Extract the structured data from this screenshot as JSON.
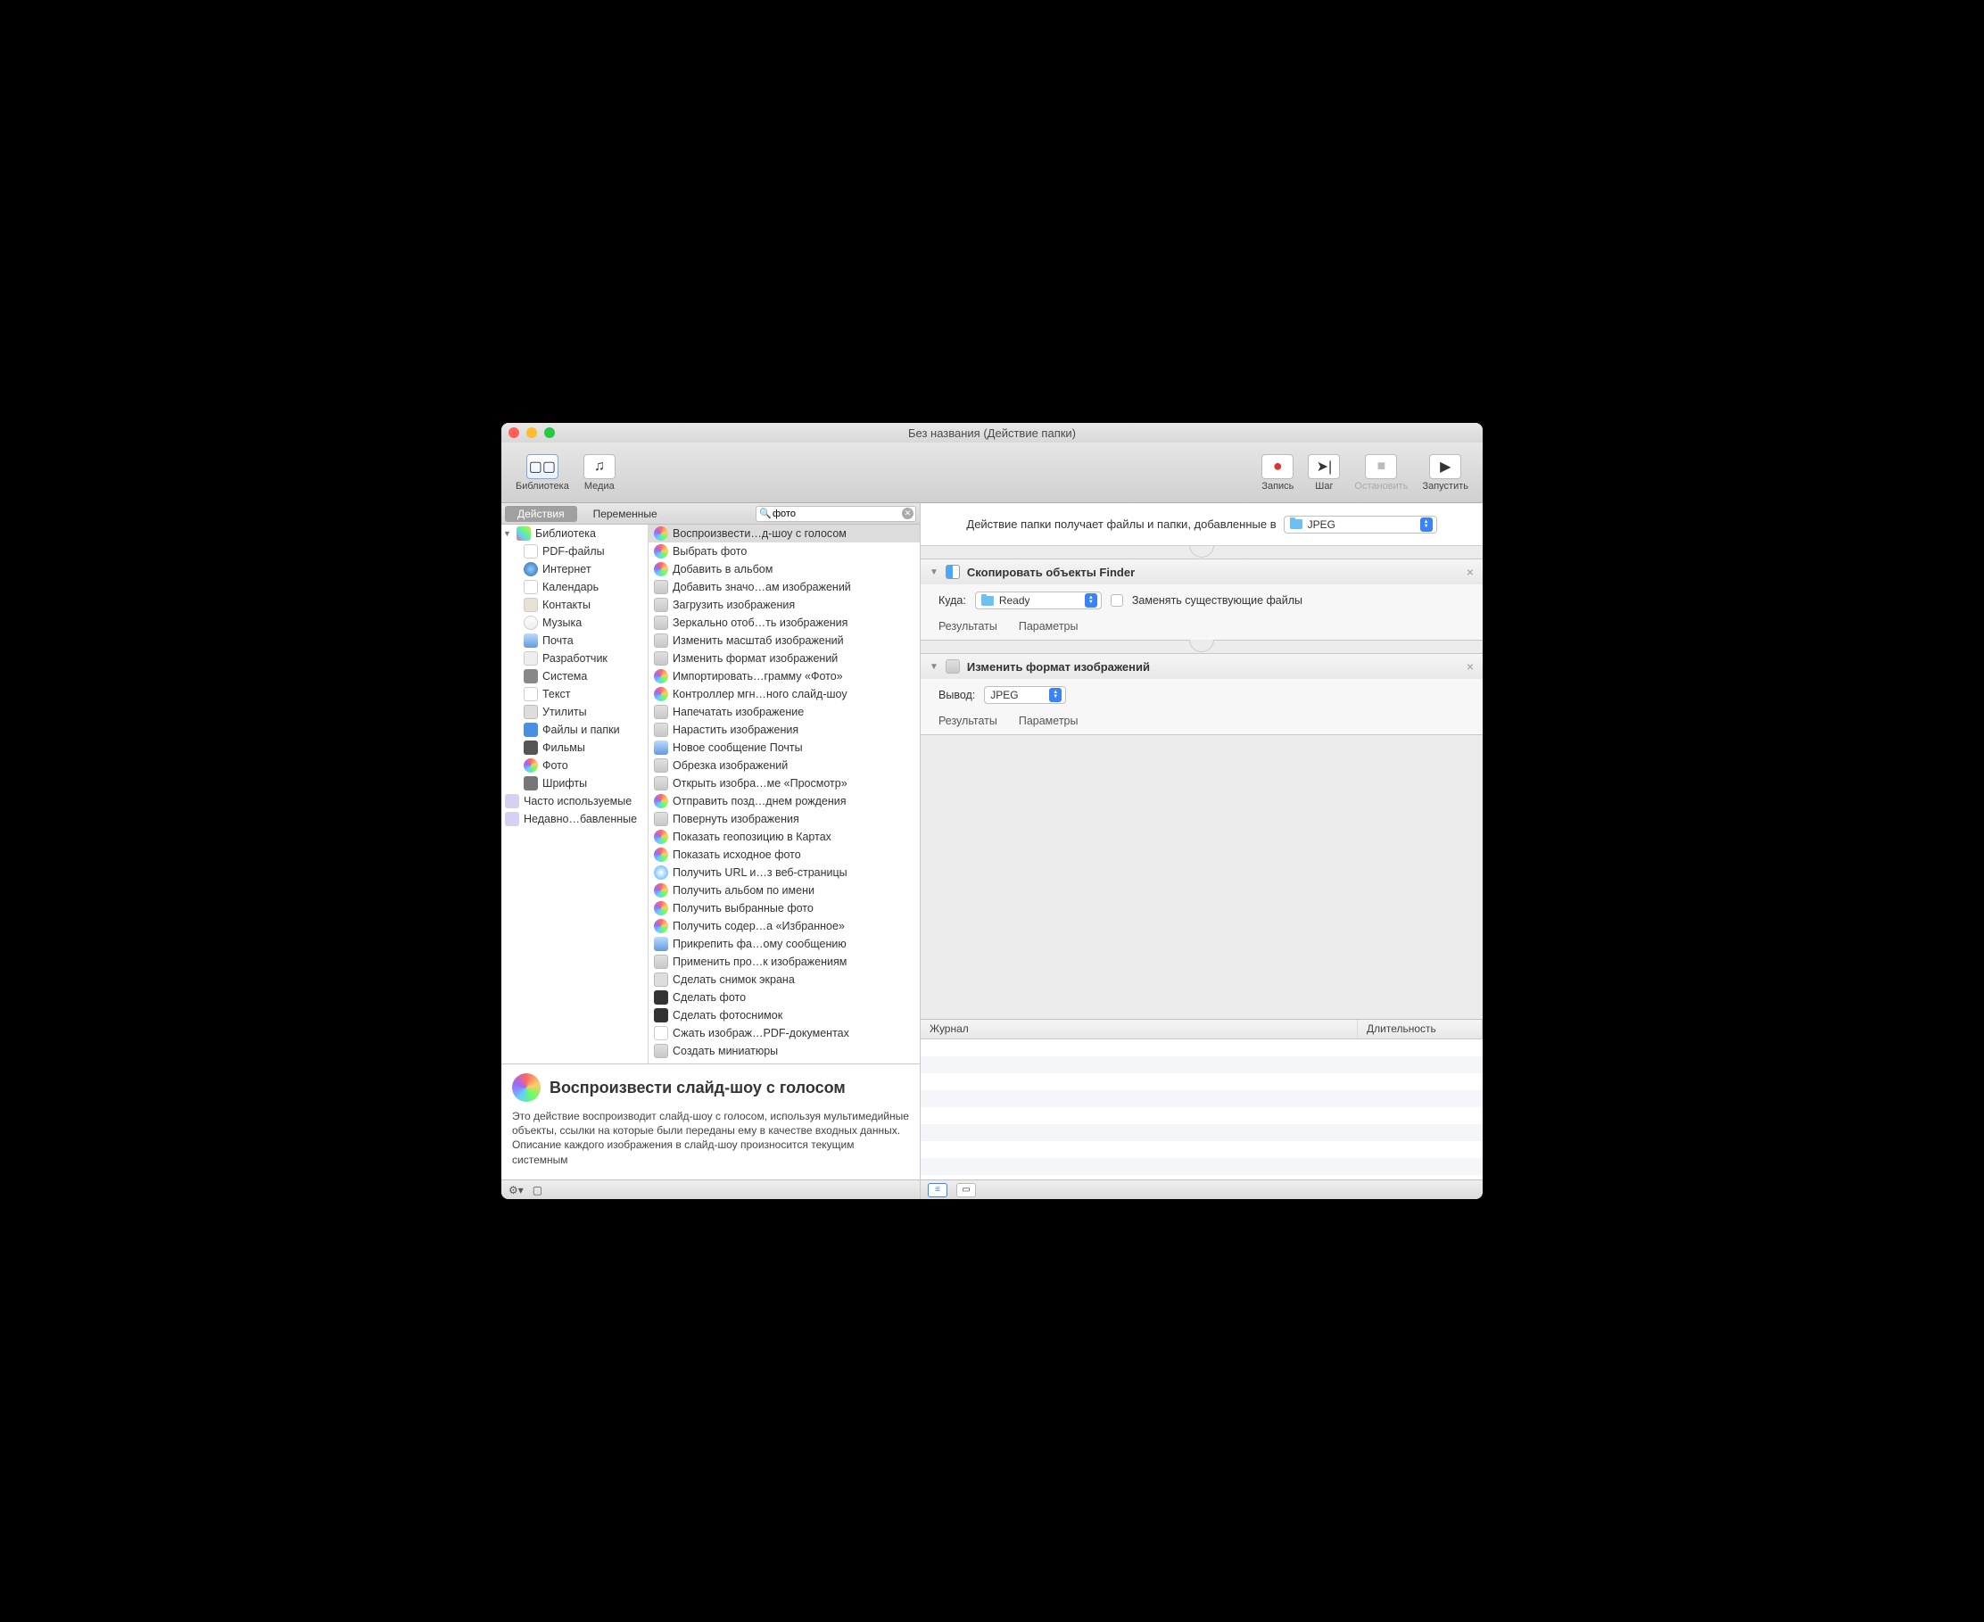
{
  "window": {
    "title": "Без названия (Действие папки)"
  },
  "toolbar": {
    "library": "Библиотека",
    "media": "Медиа",
    "record": "Запись",
    "step": "Шаг",
    "stop": "Остановить",
    "run": "Запустить"
  },
  "tabs": {
    "actions": "Действия",
    "variables": "Переменные"
  },
  "search": {
    "value": "фото"
  },
  "categories": [
    {
      "label": "Библиотека",
      "icon": "lib",
      "top": true
    },
    {
      "label": "PDF-файлы",
      "icon": "pdf"
    },
    {
      "label": "Интернет",
      "icon": "net"
    },
    {
      "label": "Календарь",
      "icon": "cal"
    },
    {
      "label": "Контакты",
      "icon": "con"
    },
    {
      "label": "Музыка",
      "icon": "mus"
    },
    {
      "label": "Почта",
      "icon": "mail"
    },
    {
      "label": "Разработчик",
      "icon": "dev"
    },
    {
      "label": "Система",
      "icon": "sys"
    },
    {
      "label": "Текст",
      "icon": "txt"
    },
    {
      "label": "Утилиты",
      "icon": "util"
    },
    {
      "label": "Файлы и папки",
      "icon": "file"
    },
    {
      "label": "Фильмы",
      "icon": "film"
    },
    {
      "label": "Фото",
      "icon": "photo"
    },
    {
      "label": "Шрифты",
      "icon": "font"
    },
    {
      "label": "Часто используемые",
      "icon": "fav",
      "group": true
    },
    {
      "label": "Недавно…бавленные",
      "icon": "fav",
      "group": true
    }
  ],
  "actions": [
    {
      "label": "Воспроизвести…д-шоу с голосом",
      "icon": "photo",
      "selected": true
    },
    {
      "label": "Выбрать фото",
      "icon": "photo"
    },
    {
      "label": "Добавить в альбом",
      "icon": "photo"
    },
    {
      "label": "Добавить значо…ам изображений",
      "icon": "img"
    },
    {
      "label": "Загрузить изображения",
      "icon": "img"
    },
    {
      "label": "Зеркально отоб…ть изображения",
      "icon": "img"
    },
    {
      "label": "Изменить масштаб изображений",
      "icon": "img"
    },
    {
      "label": "Изменить формат изображений",
      "icon": "img"
    },
    {
      "label": "Импортировать…грамму «Фото»",
      "icon": "photo"
    },
    {
      "label": "Контроллер мгн…ного слайд-шоу",
      "icon": "photo"
    },
    {
      "label": "Напечатать изображение",
      "icon": "img"
    },
    {
      "label": "Нарастить изображения",
      "icon": "img"
    },
    {
      "label": "Новое сообщение Почты",
      "icon": "mail"
    },
    {
      "label": "Обрезка изображений",
      "icon": "img"
    },
    {
      "label": "Открыть изобра…ме «Просмотр»",
      "icon": "img"
    },
    {
      "label": "Отправить позд…днем рождения",
      "icon": "photo"
    },
    {
      "label": "Повернуть изображения",
      "icon": "img"
    },
    {
      "label": "Показать геопозицию в Картах",
      "icon": "photo"
    },
    {
      "label": "Показать исходное фото",
      "icon": "photo"
    },
    {
      "label": "Получить URL и…з веб-страницы",
      "icon": "saf"
    },
    {
      "label": "Получить альбом по имени",
      "icon": "photo"
    },
    {
      "label": "Получить выбранные фото",
      "icon": "photo"
    },
    {
      "label": "Получить содер…а «Избранное»",
      "icon": "photo"
    },
    {
      "label": "Прикрепить фа…ому сообщению",
      "icon": "mail"
    },
    {
      "label": "Применить про…к изображениям",
      "icon": "img"
    },
    {
      "label": "Сделать снимок экрана",
      "icon": "util"
    },
    {
      "label": "Сделать фото",
      "icon": "cam"
    },
    {
      "label": "Сделать фотоснимок",
      "icon": "cam"
    },
    {
      "label": "Сжать изображ…PDF-документах",
      "icon": "pdf"
    },
    {
      "label": "Создать миниатюры",
      "icon": "img"
    }
  ],
  "description": {
    "title": "Воспроизвести слайд-шоу с голосом",
    "text": "Это действие воспроизводит слайд-шоу с голосом, используя мультимедийные объекты, ссылки на которые были переданы ему в качестве входных данных. Описание каждого изображения в слайд-шоу произносится текущим системным"
  },
  "workflow_header": {
    "text": "Действие папки получает файлы и папки, добавленные в",
    "folder": "JPEG"
  },
  "workflow": [
    {
      "title": "Скопировать объекты Finder",
      "icon": "finder",
      "fields": {
        "dest_label": "Куда:",
        "dest_value": "Ready",
        "replace": "Заменять существующие файлы"
      },
      "footer": {
        "results": "Результаты",
        "params": "Параметры"
      }
    },
    {
      "title": "Изменить формат изображений",
      "icon": "img",
      "fields": {
        "out_label": "Вывод:",
        "out_value": "JPEG"
      },
      "footer": {
        "results": "Результаты",
        "params": "Параметры"
      }
    }
  ],
  "log": {
    "col_journal": "Журнал",
    "col_duration": "Длительность"
  }
}
